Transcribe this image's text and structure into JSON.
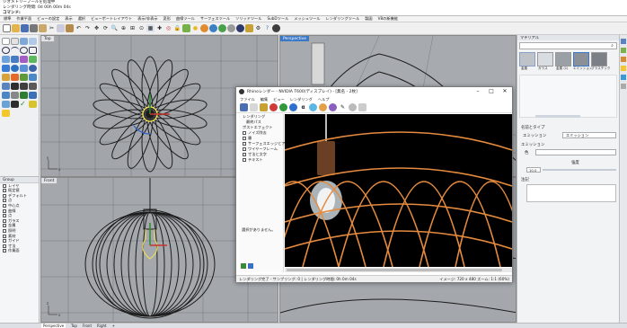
{
  "command_history": {
    "line1": "ジオメトリーブールを処理中",
    "line2": "レンダリング時間: 0d 00h 00m 04s",
    "prompt": "コマンド:"
  },
  "menu": [
    "標準",
    "作業平面",
    "ビューの設定",
    "表示",
    "選択",
    "ビューポートレイアウト",
    "表示/非表示",
    "変形",
    "曲線ツール",
    "サーフェスツール",
    "ソリッドツール",
    "SubDツール",
    "メッシュツール",
    "レンダリングツール",
    "製図",
    "V8の新機能"
  ],
  "viewports": {
    "top": "Top",
    "perspective": "Perspective",
    "front": "Front",
    "axis_x": "x",
    "axis_y": "y",
    "axis_z": "z"
  },
  "layers": {
    "header": "Group",
    "items": [
      "レイヤ",
      "既定値",
      "デフォルト",
      "点",
      "中心点",
      "曲線",
      "点",
      "ガラス",
      "金属",
      "照明",
      "素材",
      "ガイド",
      "寸法",
      "作業面"
    ]
  },
  "render_window": {
    "title": "Rhinoレンダー - NVIDIA T600(ディスプレイ) - [無名 - 2枚]",
    "menu": [
      "ファイル",
      "編集",
      "ビュー",
      "レンダリング",
      "ヘルプ"
    ],
    "side_items": [
      "レンダリング",
      "最終パス",
      "ポストエフェクト",
      "ノイズ除去",
      "霧",
      "サーフェスエッジとアイソ",
      "ワイヤーフレーム",
      "寸法と文字",
      "テキスト"
    ],
    "side_message": "選択がありません。",
    "status": "レンダリング完了 - サンプリング: 0 | レンダリング時間: 0h 0m 04s",
    "status_right": "イメージ: 720 x 480  ズーム: 1:1 (60%)"
  },
  "right_panel": {
    "search_placeholder": "マテリアル",
    "materials": [
      "金属",
      "ガラス",
      "金属 (1)",
      "エミッション",
      "プラスチック"
    ],
    "sections": {
      "name_type": "名前とタイプ",
      "emission_label": "エミッション",
      "emission_value": "エミッション",
      "emission_section": "エミッション",
      "color_label": "色",
      "intensity_label": "強度",
      "intensity_value": "10.0",
      "notes": "注記"
    }
  },
  "status_tabs": [
    "Perspective",
    "Top",
    "Front",
    "Right",
    "+"
  ],
  "colors": {
    "wire": "#1c1c1c",
    "lamp_cord": "#e58b3f",
    "accent": "#3a78c8",
    "selection": "#f4e44c"
  }
}
